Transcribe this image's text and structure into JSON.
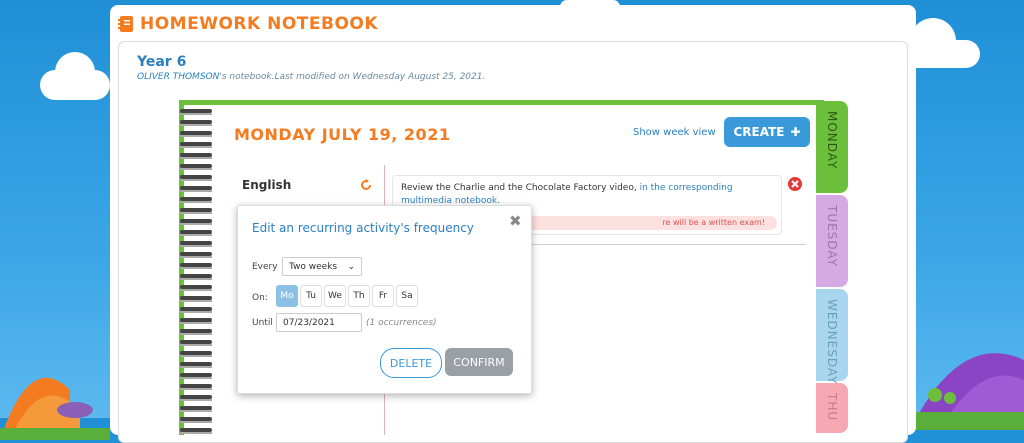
{
  "app": {
    "title": "HOMEWORK NOTEBOOK",
    "icon": "notebook-icon"
  },
  "header": {
    "class_name": "Year 6",
    "owner": "OLIVER THOMSON",
    "modified_text": "'s notebook.Last modified on Wednesday August 25, 2021."
  },
  "notebook": {
    "date_title": "MONDAY JULY 19, 2021",
    "week_view_link": "Show week view",
    "create_label": "CREATE",
    "subject": "English",
    "task": {
      "text": "Review the Charlie and the Chocolate Factory video, ",
      "link_text": "in the corresponding multimedia notebook.",
      "note": "re will be a written exam!"
    },
    "tabs": [
      "MONDAY",
      "TUESDAY",
      "WEDNESDAY",
      "THU"
    ]
  },
  "popup": {
    "title": "Edit an recurring activity's frequency",
    "close_glyph": "✖",
    "every_label": "Every",
    "every_value": "Two weeks",
    "on_label": "On:",
    "days": [
      "Mo",
      "Tu",
      "We",
      "Th",
      "Fr",
      "Sa"
    ],
    "selected_day": "Mo",
    "until_label": "Until",
    "until_value": "07/23/2021",
    "occurrences": "(1 occurrences)",
    "delete_label": "DELETE",
    "confirm_label": "CONFIRM"
  },
  "colors": {
    "accent_orange": "#f47b20",
    "accent_blue": "#2a7fc1",
    "notebook_green": "#6cbf3a"
  }
}
